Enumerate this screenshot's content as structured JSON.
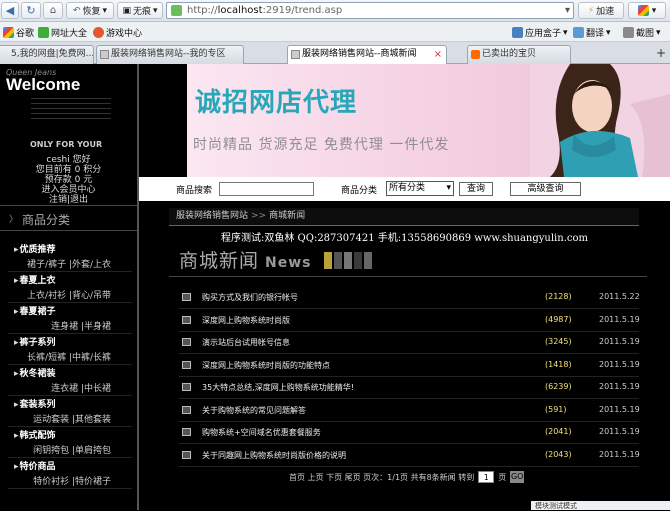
{
  "browser": {
    "back_label": "",
    "refresh_label": "",
    "home_label": "",
    "restore_label": "恢复",
    "noshadow_label": "无痕",
    "url_prefix": "http://",
    "url_host": "localhost",
    "url_rest": ":2919/trend.asp",
    "accelerate_label": "加速"
  },
  "favorites": {
    "items": [
      "谷歌",
      "网址大全",
      "游戏中心"
    ],
    "right_items": [
      "应用盒子",
      "翻译",
      "截图"
    ]
  },
  "tabs": [
    {
      "label": "5,我的网盘|免费网..."
    },
    {
      "label": "服装网络销售网站--我的专区"
    },
    {
      "label": "服装网络销售网站--商城新闻"
    },
    {
      "label": "已卖出的宝贝"
    }
  ],
  "logo": {
    "small": "Queen Jeans",
    "big": "Welcome"
  },
  "only_for": "ONLY FOR YOUR",
  "user": {
    "name_line": "ceshi  您好",
    "level_line": "您目前有 0 积分",
    "deposit_line": "预存款  0 元",
    "member_center": "进入会员中心",
    "logout": "注销|退出"
  },
  "category_title": "商品分类",
  "categories": [
    {
      "name": "优质推荐",
      "subs": [
        "裙子/裤子 |外套/上衣"
      ]
    },
    {
      "name": "春夏上衣",
      "subs": [
        "上衣/衬衫 |背心/吊带"
      ]
    },
    {
      "name": "春夏裙子",
      "subs": [
        "连身裙 |半身裙"
      ]
    },
    {
      "name": "裤子系列",
      "subs": [
        "长裤/短裤 |中裤/长裤"
      ]
    },
    {
      "name": "秋冬裙装",
      "subs": [
        "连衣裙 |中长裙"
      ]
    },
    {
      "name": "套装系列",
      "subs": [
        "运动套装 |其他套装"
      ]
    },
    {
      "name": "韩式配饰",
      "subs": [
        "闲钥挎包 |单肩挎包"
      ]
    },
    {
      "name": "特价商品",
      "subs": [
        "特价衬衫 |特价裙子"
      ]
    }
  ],
  "banner": {
    "title": "诚招网店代理",
    "slogans": "时尚精品  货源充足  免费代理  一件代发"
  },
  "search": {
    "label": "商品搜索",
    "category_label": "商品分类",
    "category_value": "所有分类",
    "search_button": "查询",
    "advanced_button": "高级查询"
  },
  "breadcrumb": {
    "home": "服装网络销售网站",
    "separator": ">>",
    "current": "商城新闻"
  },
  "credit_line": "程序测试:双鱼林 QQ:287307421 手机:13558690869 www.shuangyulin.com",
  "section": {
    "title_cn": "商城新闻",
    "title_en": "News"
  },
  "news": [
    {
      "title": "购买方式及我们的银行帐号",
      "count": "(2128)",
      "date": "2011.5.22"
    },
    {
      "title": "深度网上购物系统时尚版",
      "count": "(4987)",
      "date": "2011.5.19"
    },
    {
      "title": "演示站后台试用帐号信息",
      "count": "(3245)",
      "date": "2011.5.19"
    },
    {
      "title": "深度网上购物系统时尚版的功能特点",
      "count": "(1418)",
      "date": "2011.5.19"
    },
    {
      "title": "35大特点总结,深度网上购物系统功能精华!",
      "count": "(6239)",
      "date": "2011.5.19"
    },
    {
      "title": "关于购物系统的常见问题解答",
      "count": "(591)",
      "date": "2011.5.19"
    },
    {
      "title": "购物系统+空间域名优惠套餐服务",
      "count": "(2041)",
      "date": "2011.5.19"
    },
    {
      "title": "关于同趣网上购物系统时尚版价格的说明",
      "count": "(2043)",
      "date": "2011.5.19"
    }
  ],
  "pager": {
    "text": "首页 上页 下页 尾页 页次：1/1页 共有8条新闻 转到",
    "page_value": "1",
    "page_suffix": "页",
    "go_label": "GO"
  },
  "status_text": "模块测试模式"
}
